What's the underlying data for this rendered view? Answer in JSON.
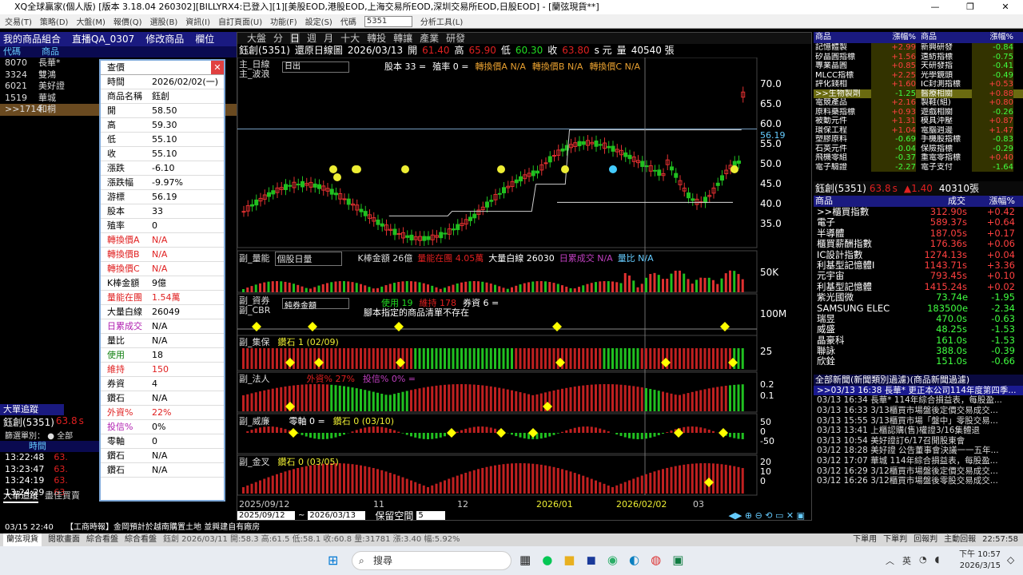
{
  "window": {
    "title": "XQ全球贏家(個人版) [版本 3.18.04 260302][BILLYRX4:已登入][1][美股EOD,港股EOD,上海交易所EOD,深圳交易所EOD,日股EOD] - [蘭弦現貨**]",
    "min": "—",
    "max": "❐",
    "close": "✕"
  },
  "menu": [
    "交易(T)",
    "策略(D)",
    "大盤(M)",
    "報價(Q)",
    "選股(B)",
    "資訊(I)",
    "自訂頁面(U)",
    "功能(F)",
    "設定(S)",
    "代碼"
  ],
  "menu_symbol": "5351",
  "menu_tools": "分析工具(L)",
  "left": {
    "title": "我的商品組合",
    "title2": "直播QA_0307",
    "title3": "修改商品",
    "title4": "欄位",
    "cols": [
      "代碼",
      "商品"
    ],
    "rows": [
      {
        "code": "8070",
        "name": "長華*"
      },
      {
        "code": "3324",
        "name": "雙鴻"
      },
      {
        "code": "6021",
        "name": "美好證"
      },
      {
        "code": "1519",
        "name": "華城"
      },
      {
        "code": ">>1714",
        "name": "和桐"
      }
    ]
  },
  "popup": {
    "title": "查價",
    "rows": [
      {
        "k": "時間",
        "v": "2026/02/02(一)"
      },
      {
        "k": "商品名稱",
        "v": "鈺創"
      },
      {
        "k": "開",
        "v": "58.50"
      },
      {
        "k": "高",
        "v": "59.30"
      },
      {
        "k": "低",
        "v": "55.10"
      },
      {
        "k": "收",
        "v": "55.10"
      },
      {
        "k": "漲跌",
        "v": "-6.10"
      },
      {
        "k": "漲跌幅",
        "v": "-9.97%"
      },
      {
        "k": "游標",
        "v": "56.19"
      },
      {
        "k": "股本",
        "v": "33"
      },
      {
        "k": "殖率",
        "v": "0"
      },
      {
        "k": "轉換價A",
        "v": "N/A"
      },
      {
        "k": "轉換價B",
        "v": "N/A"
      },
      {
        "k": "轉換價C",
        "v": "N/A"
      },
      {
        "k": "K棒金額",
        "v": "9億"
      },
      {
        "k": "量能在團",
        "v": "1.54萬"
      },
      {
        "k": "大量白線",
        "v": "26049"
      },
      {
        "k": "日累成交",
        "v": "N/A"
      },
      {
        "k": "量比",
        "v": "N/A"
      },
      {
        "k": "使用",
        "v": "18"
      },
      {
        "k": "維持",
        "v": "150"
      },
      {
        "k": "券資",
        "v": "4"
      },
      {
        "k": "鑽石",
        "v": "N/A"
      },
      {
        "k": "外資%",
        "v": "22%"
      },
      {
        "k": "投信%",
        "v": "0%"
      },
      {
        "k": "零軸",
        "v": "0"
      },
      {
        "k": "鑽石",
        "v": "N/A"
      },
      {
        "k": "鑽石",
        "v": "N/A"
      }
    ]
  },
  "bigtrack": {
    "title": "大單追蹤",
    "stock": "鈺創(5351)",
    "price": "63.8",
    "suffix": "s",
    "filter": "篩選單別：",
    "opt": "全部",
    "col": "時間",
    "times": [
      "13:22:48",
      "13:23:47",
      "13:24:19",
      "13:24:29"
    ],
    "tabs": [
      "大單追蹤",
      "盡佳買賣"
    ]
  },
  "chart": {
    "tabs": [
      "大盤",
      "分",
      "日",
      "週",
      "月",
      "十大",
      "轉投",
      "轉讓",
      "產業",
      "研發"
    ],
    "stock": "鈺創(5351)",
    "mode": "還原日線圖",
    "date": "2026/03/13",
    "open_l": "開",
    "open": "61.40",
    "high_l": "高",
    "high": "65.90",
    "low_l": "低",
    "low": "60.30",
    "close_l": "收",
    "close": "63.80",
    "unit": "s 元",
    "vol_l": "量",
    "vol": "40540 張",
    "main_label": "主_日線",
    "main_label2": "主_波浪",
    "period_sel": "日出",
    "capital": "股本 33 =",
    "yield": "殖率 0 =",
    "conv": [
      "轉換價A N/A",
      "轉換價B N/A",
      "轉換價C N/A"
    ],
    "price_ticks": [
      "70.0",
      "65.0",
      "60.0",
      "55.0",
      "50.0",
      "45.0",
      "40.0",
      "35.0"
    ],
    "cursor_val": "56.19",
    "panels": [
      {
        "label": "副_量能",
        "sel": "個股日量",
        "info": "K棒金額 26億",
        "info2": "量能在團 4.05萬",
        "info3": "大量白線 26030",
        "info4": "日累成交 N/A",
        "info5": "量比 N/A",
        "tick": "50K"
      },
      {
        "label": "副_資券",
        "label2": "副_CBR",
        "sel": "純券金額",
        "info": "使用 19",
        "info2": "維持 178",
        "info3": "券資 6 =",
        "note": "腳本指定的商品清單不存在",
        "tick": "100M"
      },
      {
        "label": "副_集保",
        "info": "鑽石 1 (02/09)",
        "tick": "25"
      },
      {
        "label": "副_法人",
        "info": "外資% 27%",
        "info2": "投信% 0% =",
        "ticks": [
          "0.2",
          "0.1"
        ]
      },
      {
        "label": "副_威廉",
        "info": "零軸 0 =",
        "info2": "鑽石 0 (03/10)",
        "ticks": [
          "50",
          "0",
          "-50"
        ]
      },
      {
        "label": "副_金叉",
        "info": "鑽石 0 (03/05)",
        "ticks": [
          "20",
          "10",
          "0"
        ]
      }
    ],
    "xlabels": [
      "2025/09/12",
      "11",
      "12",
      "2026/01",
      "2026/02/02",
      "03"
    ],
    "bottom": {
      "from": "2025/09/12",
      "to": "2026/03/13",
      "keep": "保留空間",
      "keepval": "5"
    }
  },
  "quotes": {
    "cols": [
      "商品",
      "漲幅%",
      "商品",
      "漲幅%"
    ],
    "rows": [
      [
        "記憶體製",
        "+2.99",
        "新興研發",
        "-0.84"
      ],
      [
        "矽晶圓指標",
        "+1.56",
        "遠紡指標",
        "-0.75"
      ],
      [
        "專業晶圓",
        "+0.85",
        "天研發指",
        "-0.41"
      ],
      [
        "MLCC指標",
        "+2.25",
        "光學鏡頭",
        "-0.49"
      ],
      [
        "評化錢相",
        "+1.60",
        "IC封測指標",
        "+0.53"
      ],
      [
        ">>生物製劑",
        "-1.25",
        "醫療相關",
        "+0.88"
      ],
      [
        "電競產品",
        "+2.16",
        "製鞋(組)",
        "+0.80"
      ],
      [
        "原料藥指標",
        "+0.93",
        "遊戲相關",
        "-0.26"
      ],
      [
        "被動元件",
        "+1.31",
        "模具沖壓",
        "+0.87"
      ],
      [
        "環保工程",
        "+1.04",
        "電腦週邊",
        "+1.47"
      ],
      [
        "塑膠原料",
        "-0.69",
        "手機股指標",
        "-0.83"
      ],
      [
        "石英元件",
        "-0.04",
        "保險指標",
        "-0.29"
      ],
      [
        "飛機零組",
        "-0.37",
        "重電零指標",
        "+0.40"
      ],
      [
        "電子驗證",
        "-2.27",
        "電子支付",
        "-1.64"
      ]
    ]
  },
  "stock_hdr": {
    "name": "鈺創(5351)",
    "price": "63.8",
    "s": "s",
    "chg": "▲1.40",
    "vol": "40310張"
  },
  "sector": {
    "cols": [
      "商品",
      "成交",
      "漲幅%"
    ],
    "rows": [
      [
        ">>櫃買指數",
        "312.90",
        "s",
        "+0.42"
      ],
      [
        "電子",
        "589.37",
        "s",
        "+0.64"
      ],
      [
        "半導體",
        "187.05",
        "s",
        "+0.17"
      ],
      [
        "櫃買薪酬指數",
        "176.36",
        "s",
        "+0.06"
      ],
      [
        "IC設計指數",
        "1274.13",
        "s",
        "+0.04"
      ],
      [
        "利基型記憶體I",
        "1143.71",
        "s",
        "+3.36"
      ],
      [
        "元宇宙",
        "793.45",
        "s",
        "+0.10"
      ],
      [
        "利基型記憶體",
        "1415.24",
        "s",
        "+0.02"
      ],
      [
        "紫光國微",
        "73.74",
        "e",
        "-1.95"
      ],
      [
        "SAMSUNG ELEC",
        "183500",
        "e",
        "-2.34"
      ],
      [
        "瑞昱",
        "470.0",
        "s",
        "-0.63"
      ],
      [
        "威盛",
        "48.25",
        "s",
        "-1.53"
      ],
      [
        "晶豪科",
        "161.0",
        "s",
        "-1.53"
      ],
      [
        "聯詠",
        "388.0",
        "s",
        "-0.39"
      ],
      [
        "欣銓",
        "151.0",
        "s",
        "-0.66"
      ]
    ]
  },
  "news": {
    "title": "全部新聞(新聞類別過濾)(商品新聞過濾)",
    "rows": [
      ">>03/13 16:38 長華* 更正本公司114年度第四季...",
      "03/13 16:34 長華* 114年綜合損益表，每股盈...",
      "03/13 16:33 3/13櫃買市場盤後定價交易成交...",
      "03/13 15:55 3/13櫃買市場「盤中」零股交易...",
      "03/13 13:41 上櫃認購(售)權證3/16集體退",
      "03/13 10:54 美好證訂6/17召開股東會",
      "03/12 18:28 美好證 公告董事會決議一一五年...",
      "03/12 17:07 華城 114年綜合損益表，每股盈...",
      "03/12 16:29 3/12櫃買市場盤後定價交易成交...",
      "03/12 16:26 3/12櫃買市場盤後零股交易成交..."
    ]
  },
  "newsbar": {
    "time": "03/15 22:40",
    "text": "【工商時報】金岡預計於越南購置土地 並興建自有廠房"
  },
  "status": [
    "蘭弦現貨",
    "閱歌畫面",
    "綜合看盤",
    "綜合看盤",
    "鈺創 2026/03/11 開:58.3 高:61.5 低:58.1 收:60.8 量:31781 漲:3.40 幅:5.92%",
    "下單用",
    "下單判",
    "回報判",
    "主動回報",
    "22:57:58"
  ],
  "taskbar": {
    "search": "搜尋",
    "ime": "英",
    "time": "下午 10:57",
    "date": "2026/3/15"
  }
}
